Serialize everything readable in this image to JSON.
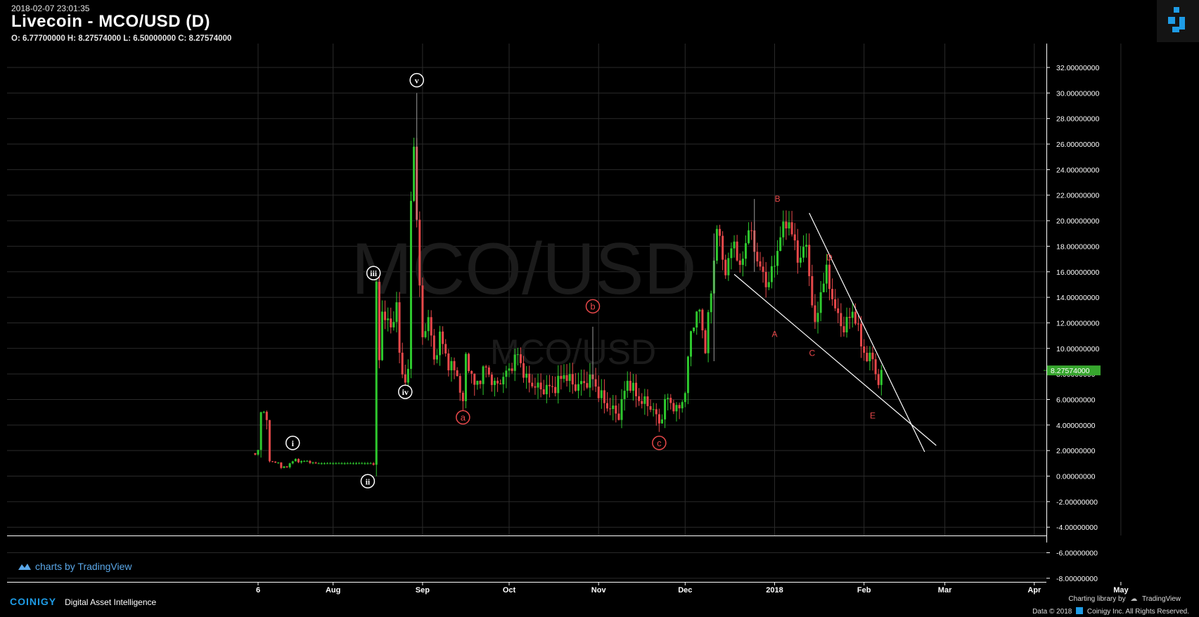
{
  "header": {
    "timestamp": "2018-02-07 23:01:35",
    "title": "Livecoin - MCO/USD (D)",
    "ohlc": "O: 6.77700000 H: 8.27574000 L: 6.50000000 C: 8.27574000"
  },
  "watermark": {
    "big": "MCO/USD",
    "small": "MCO/USD"
  },
  "tv_badge": "charts by TradingView",
  "footer": {
    "brand": "COINIGY",
    "tagline": "Digital Asset Intelligence",
    "charting_by": "Charting library by",
    "charting_brand": "TradingView",
    "copyright": "Data © 2018",
    "copyright2": "Coinigy Inc. All Rights Reserved."
  },
  "colors": {
    "up": "#2ec82e",
    "down": "#e8484a",
    "grid": "#2a2a2a",
    "axis": "#ffffff",
    "price_badge": "#37a62e",
    "logo": "#1e9ce6"
  },
  "chart_data": {
    "type": "candlestick",
    "y_ticks": [
      "32.00000000",
      "30.00000000",
      "28.00000000",
      "26.00000000",
      "24.00000000",
      "22.00000000",
      "20.00000000",
      "18.00000000",
      "16.00000000",
      "14.00000000",
      "12.00000000",
      "10.00000000",
      "8.00000000",
      "6.00000000",
      "4.00000000",
      "2.00000000",
      "0.00000000",
      "-2.00000000",
      "-4.00000000",
      "-6.00000000",
      "-8.00000000"
    ],
    "y_tick_values": [
      32,
      30,
      28,
      26,
      24,
      22,
      20,
      18,
      16,
      14,
      12,
      10,
      8,
      6,
      4,
      2,
      0,
      -2,
      -4,
      -6,
      -8
    ],
    "ylim": [
      -8.5,
      33.7
    ],
    "x_ticks": [
      {
        "label": "6",
        "date": "2017-07-06"
      },
      {
        "label": "Aug",
        "date": "2017-08-01"
      },
      {
        "label": "Sep",
        "date": "2017-09-01"
      },
      {
        "label": "Oct",
        "date": "2017-10-01"
      },
      {
        "label": "Nov",
        "date": "2017-11-01"
      },
      {
        "label": "Dec",
        "date": "2017-12-01"
      },
      {
        "label": "2018",
        "date": "2018-01-01"
      },
      {
        "label": "Feb",
        "date": "2018-02-01"
      },
      {
        "label": "Mar",
        "date": "2018-03-01"
      },
      {
        "label": "Apr",
        "date": "2018-04-01"
      },
      {
        "label": "May",
        "date": "2018-05-01"
      }
    ],
    "last_price": 8.27574,
    "last_price_label": "8.27574000",
    "waypoints": [
      [
        "2017-07-05",
        1.8
      ],
      [
        "2017-07-06",
        2.0
      ],
      [
        "2017-07-07",
        4.9
      ],
      [
        "2017-07-09",
        4.9
      ],
      [
        "2017-07-10",
        1.1
      ],
      [
        "2017-07-13",
        1.1
      ],
      [
        "2017-07-14",
        0.6
      ],
      [
        "2017-07-16",
        0.8
      ],
      [
        "2017-07-19",
        1.3
      ],
      [
        "2017-07-21",
        1.1
      ],
      [
        "2017-07-23",
        1.2
      ],
      [
        "2017-07-25",
        1.0
      ],
      [
        "2017-08-15",
        1.0
      ],
      [
        "2017-08-16",
        14.8
      ],
      [
        "2017-08-17",
        9.0
      ],
      [
        "2017-08-18",
        13.0
      ],
      [
        "2017-08-21",
        11.5
      ],
      [
        "2017-08-23",
        13.5
      ],
      [
        "2017-08-24",
        9.5
      ],
      [
        "2017-08-25",
        7.8
      ],
      [
        "2017-08-27",
        8.0
      ],
      [
        "2017-08-28",
        21.5
      ],
      [
        "2017-08-29",
        25.8
      ],
      [
        "2017-08-30",
        20.5
      ],
      [
        "2017-08-31",
        14.5
      ],
      [
        "2017-09-01",
        10.8
      ],
      [
        "2017-09-03",
        12.5
      ],
      [
        "2017-09-05",
        9.0
      ],
      [
        "2017-09-07",
        11.0
      ],
      [
        "2017-09-10",
        8.8
      ],
      [
        "2017-09-13",
        8.0
      ],
      [
        "2017-09-15",
        5.5
      ],
      [
        "2017-09-16",
        9.5
      ],
      [
        "2017-09-19",
        7.0
      ],
      [
        "2017-09-23",
        8.5
      ],
      [
        "2017-09-26",
        7.0
      ],
      [
        "2017-09-30",
        8.0
      ],
      [
        "2017-10-04",
        9.5
      ],
      [
        "2017-10-07",
        7.5
      ],
      [
        "2017-10-12",
        6.8
      ],
      [
        "2017-10-17",
        7.0
      ],
      [
        "2017-10-20",
        8.0
      ],
      [
        "2017-10-24",
        7.0
      ],
      [
        "2017-10-30",
        7.6
      ],
      [
        "2017-11-01",
        6.5
      ],
      [
        "2017-11-04",
        5.5
      ],
      [
        "2017-11-08",
        4.8
      ],
      [
        "2017-11-11",
        7.5
      ],
      [
        "2017-11-15",
        6.0
      ],
      [
        "2017-11-19",
        5.5
      ],
      [
        "2017-11-22",
        4.2
      ],
      [
        "2017-11-25",
        6.2
      ],
      [
        "2017-11-28",
        5.0
      ],
      [
        "2017-12-01",
        6.5
      ],
      [
        "2017-12-03",
        11.5
      ],
      [
        "2017-12-06",
        13.0
      ],
      [
        "2017-12-08",
        10.0
      ],
      [
        "2017-12-10",
        14.5
      ],
      [
        "2017-12-12",
        19.5
      ],
      [
        "2017-12-15",
        16.0
      ],
      [
        "2017-12-18",
        18.5
      ],
      [
        "2017-12-20",
        16.0
      ],
      [
        "2017-12-23",
        19.5
      ],
      [
        "2017-12-26",
        17.0
      ],
      [
        "2017-12-29",
        15.0
      ],
      [
        "2018-01-01",
        16.5
      ],
      [
        "2018-01-03",
        19.0
      ],
      [
        "2018-01-06",
        20.0
      ],
      [
        "2018-01-09",
        17.0
      ],
      [
        "2018-01-12",
        18.0
      ],
      [
        "2018-01-15",
        11.5
      ],
      [
        "2018-01-17",
        14.5
      ],
      [
        "2018-01-19",
        16.0
      ],
      [
        "2018-01-22",
        13.0
      ],
      [
        "2018-01-25",
        11.5
      ],
      [
        "2018-01-28",
        13.0
      ],
      [
        "2018-01-31",
        10.5
      ],
      [
        "2018-02-02",
        9.0
      ],
      [
        "2018-02-04",
        9.5
      ],
      [
        "2018-02-06",
        6.8
      ],
      [
        "2018-02-07",
        8.27574
      ]
    ],
    "trendlines": [
      {
        "from": [
          "2017-12-18",
          15.8
        ],
        "to": [
          "2018-02-26",
          2.4
        ]
      },
      {
        "from": [
          "2018-01-13",
          20.6
        ],
        "to": [
          "2018-02-22",
          1.9
        ]
      }
    ],
    "wave_labels_white": [
      {
        "text": "i",
        "date": "2017-07-18",
        "value": 2.6
      },
      {
        "text": "ii",
        "date": "2017-08-13",
        "value": -0.4
      },
      {
        "text": "iii",
        "date": "2017-08-15",
        "value": 15.9
      },
      {
        "text": "iv",
        "date": "2017-08-26",
        "value": 6.6
      },
      {
        "text": "v",
        "date": "2017-08-30",
        "value": 31.0
      }
    ],
    "wave_labels_red_circled": [
      {
        "text": "a",
        "date": "2017-09-15",
        "value": 4.6
      },
      {
        "text": "b",
        "date": "2017-10-30",
        "value": 13.3
      },
      {
        "text": "c",
        "date": "2017-11-22",
        "value": 2.6
      }
    ],
    "wave_labels_red": [
      {
        "text": "A",
        "date": "2018-01-01",
        "value": 10.9
      },
      {
        "text": "B",
        "date": "2018-01-02",
        "value": 21.5
      },
      {
        "text": "C",
        "date": "2018-01-14",
        "value": 9.4
      },
      {
        "text": "D",
        "date": "2018-01-20",
        "value": 16.9
      },
      {
        "text": "E",
        "date": "2018-02-04",
        "value": 4.5
      }
    ]
  }
}
